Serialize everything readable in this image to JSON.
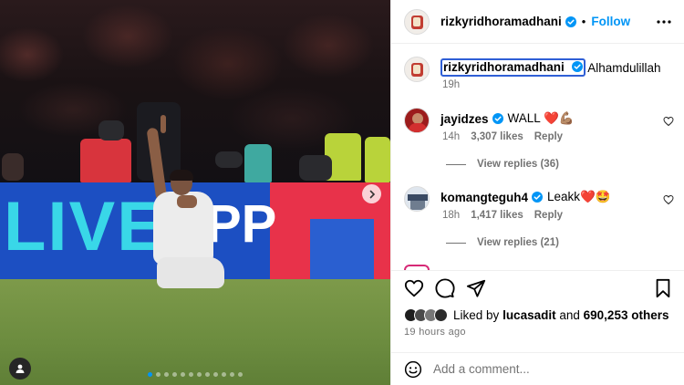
{
  "post": {
    "author": "rizkyridhoramadhani",
    "separator": "•",
    "follow_label": "Follow",
    "caption_text": "Alhamdulillah",
    "caption_time": "19h",
    "billboard_text": "LIVE",
    "billboard_text2": "PP",
    "carousel_dots": 12,
    "carousel_active": 0
  },
  "comments": [
    {
      "username": "jayidzes",
      "text": "WALL ❤️💪🏽",
      "time": "14h",
      "likes": "3,307 likes",
      "reply_label": "Reply",
      "replies_label": "View replies (36)"
    },
    {
      "username": "komangteguh4",
      "text": "Leakk❤️🤩",
      "time": "18h",
      "likes": "1,417 likes",
      "reply_label": "Reply",
      "replies_label": "View replies (21)"
    }
  ],
  "likes": {
    "prefix": "Liked by",
    "user": "lucasadit",
    "and": "and",
    "others": "690,253 others"
  },
  "time_ago": "19 hours ago",
  "add_comment": {
    "placeholder": "Add a comment..."
  },
  "colors": {
    "accent": "#0095f6",
    "verified": "#0095f6",
    "heart": "#ed4956"
  }
}
